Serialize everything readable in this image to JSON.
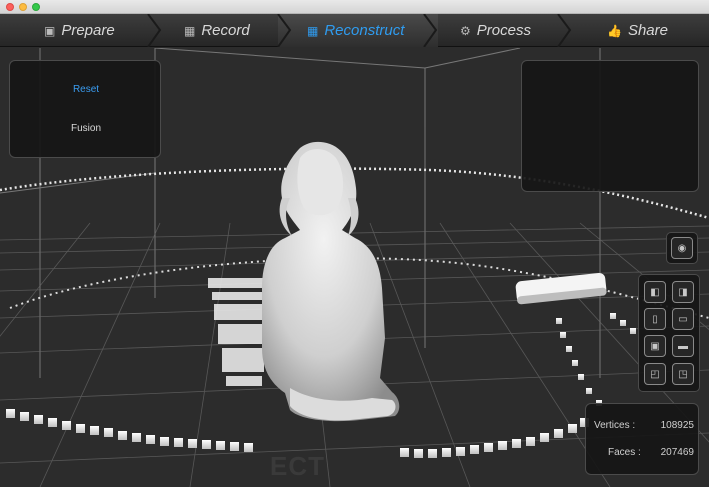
{
  "window": {
    "traffic_lights": [
      "close",
      "minimize",
      "zoom"
    ]
  },
  "steps": [
    {
      "label": "Prepare",
      "icon": "prepare-icon",
      "active": false
    },
    {
      "label": "Record",
      "icon": "record-film-icon",
      "active": false
    },
    {
      "label": "Reconstruct",
      "icon": "reconstruct-film-icon",
      "active": true
    },
    {
      "label": "Process",
      "icon": "gears-icon",
      "active": false
    },
    {
      "label": "Share",
      "icon": "thumbs-up-icon",
      "active": false
    }
  ],
  "left_panel": {
    "reset_label": "Reset",
    "fusion_label": "Fusion"
  },
  "stats": {
    "vertices_label": "Vertices :",
    "vertices_value": "108925",
    "faces_label": "Faces :",
    "faces_value": "207469"
  },
  "watermark": "ECT",
  "colors": {
    "accent": "#2f9cf0",
    "background": "#2c2c2c",
    "panel": "#161616",
    "text": "#d8d8d8"
  }
}
